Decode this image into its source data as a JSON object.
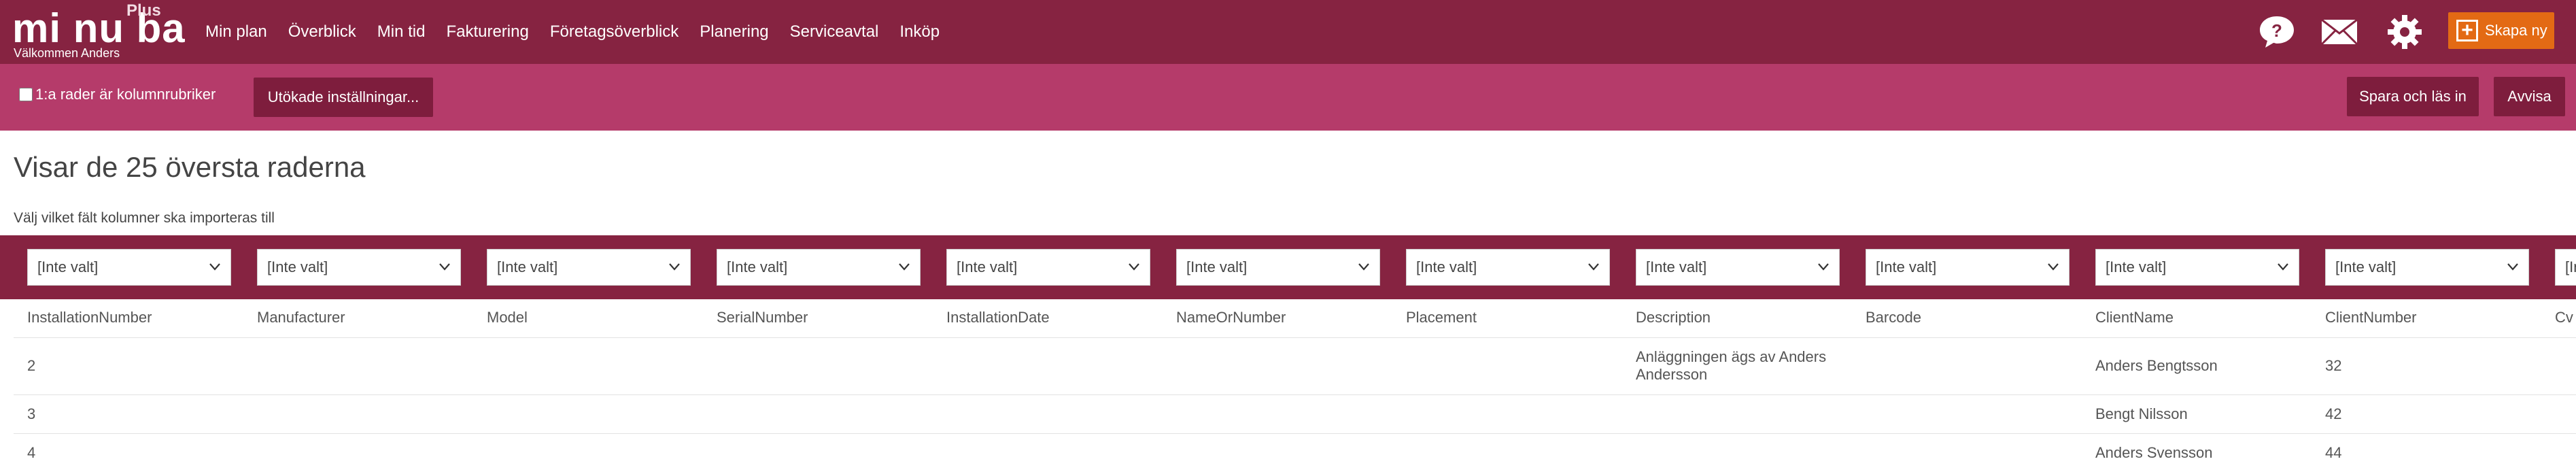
{
  "app": {
    "logo_text": "mi nu ba",
    "logo_plus": "Plus",
    "welcome": "Välkommen Anders"
  },
  "nav": [
    "Min plan",
    "Överblick",
    "Min tid",
    "Fakturering",
    "Företagsöverblick",
    "Planering",
    "Serviceavtal",
    "Inköp"
  ],
  "top_icons": [
    "help-bubble-icon",
    "mail-icon",
    "gear-icon"
  ],
  "create_button": "Skapa ny",
  "toolbar": {
    "header_checkbox_label": "1:a rader är kolumnrubriker",
    "header_checkbox_checked": false,
    "advanced_settings": "Utökade inställningar...",
    "save_and_load": "Spara och läs in",
    "reject": "Avvisa"
  },
  "page": {
    "title": "Visar de 25 översta raderna",
    "subtitle": "Välj vilket fält kolumner ska importeras till"
  },
  "select_default": "[Inte valt]",
  "columns": [
    "InstallationNumber",
    "Manufacturer",
    "Model",
    "SerialNumber",
    "InstallationDate",
    "NameOrNumber",
    "Placement",
    "Description",
    "Barcode",
    "ClientName",
    "ClientNumber",
    "Cv"
  ],
  "rows": [
    [
      "2",
      "",
      "",
      "",
      "",
      "",
      "",
      "Anläggningen ägs av Anders Andersson",
      "",
      "Anders Bengtsson",
      "32",
      ""
    ],
    [
      "3",
      "",
      "",
      "",
      "",
      "",
      "",
      "",
      "",
      "Bengt Nilsson",
      "42",
      ""
    ],
    [
      "4",
      "",
      "",
      "",
      "",
      "",
      "",
      "",
      "",
      "Anders Svensson",
      "44",
      ""
    ]
  ],
  "colors": {
    "topbar": "#862341",
    "toolbar": "#b53b6a",
    "button_dark": "#7e1d3d",
    "create_button": "#e36a14"
  }
}
